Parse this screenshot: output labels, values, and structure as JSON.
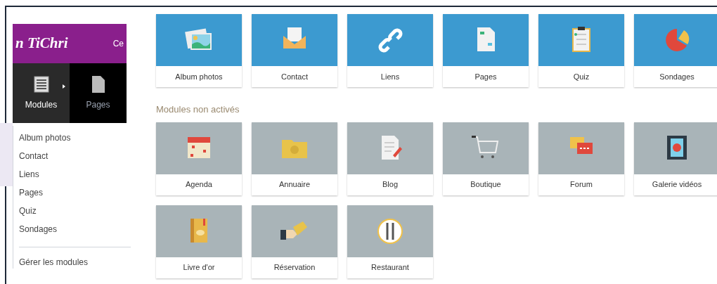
{
  "header": {
    "logo": "n TiChri",
    "link": "Ce"
  },
  "nav": [
    {
      "label": "Modules",
      "selected": true
    },
    {
      "label": "Pages",
      "selected": false
    }
  ],
  "menu": {
    "items": [
      "Album photos",
      "Contact",
      "Liens",
      "Pages",
      "Quiz",
      "Sondages"
    ],
    "footer": "Gérer les modules"
  },
  "active_modules": [
    "Album photos",
    "Contact",
    "Liens",
    "Pages",
    "Quiz",
    "Sondages"
  ],
  "inactive_modules": {
    "heading": "Modules non activés",
    "items": [
      "Agenda",
      "Annuaire",
      "Blog",
      "Boutique",
      "Forum",
      "Galerie vidéos",
      "Livre d'or",
      "Réservation",
      "Restaurant"
    ]
  }
}
